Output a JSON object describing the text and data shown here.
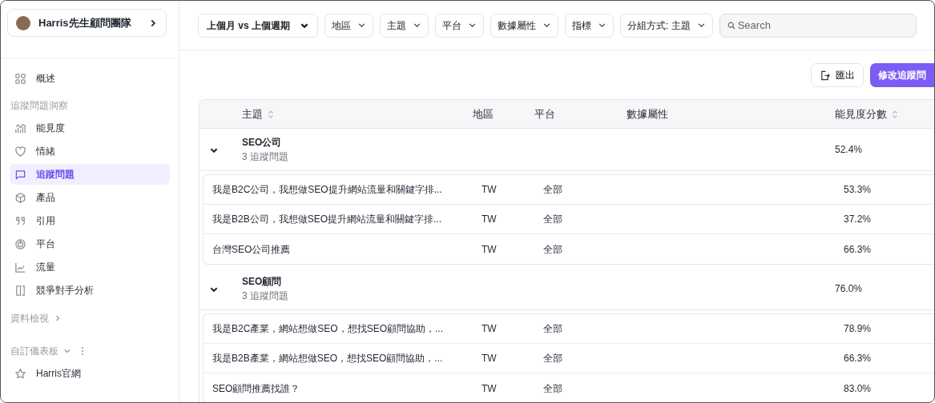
{
  "team": {
    "name": "Harris先生顧問團隊"
  },
  "sidebar": {
    "top_items": [
      {
        "label": "概述",
        "kind": "grid",
        "selected": false
      }
    ],
    "groups": [
      {
        "title": "追蹤問題洞察",
        "kind": "section",
        "items": [
          {
            "label": "能見度",
            "kind": "bars",
            "selected": false
          },
          {
            "label": "情緒",
            "kind": "heart",
            "selected": false
          },
          {
            "label": "追蹤問題",
            "kind": "chat",
            "selected": true
          },
          {
            "label": "產品",
            "kind": "cube",
            "selected": false
          },
          {
            "label": "引用",
            "kind": "quote",
            "selected": false
          },
          {
            "label": "平台",
            "kind": "target",
            "selected": false
          },
          {
            "label": "流量",
            "kind": "trend",
            "selected": false
          },
          {
            "label": "競爭對手分析",
            "kind": "split",
            "selected": false
          }
        ]
      },
      {
        "title": "資料檢視",
        "kind": "toggle",
        "expanded": false
      },
      {
        "title": "自訂儀表板",
        "kind": "toggle",
        "expanded": true,
        "has_menu": true,
        "items": [
          {
            "label": "Harris官網",
            "kind": "star",
            "selected": false
          }
        ]
      }
    ]
  },
  "filters": [
    {
      "label": "上個月 vs 上個週期",
      "kind": "period"
    },
    {
      "label": "地區",
      "kind": "dropdown"
    },
    {
      "label": "主題",
      "kind": "dropdown"
    },
    {
      "label": "平台",
      "kind": "dropdown"
    },
    {
      "label": "數據屬性",
      "kind": "dropdown"
    },
    {
      "label": "指標",
      "kind": "dropdown"
    },
    {
      "label": "分組方式: 主題",
      "kind": "dropdown"
    }
  ],
  "search": {
    "placeholder": "Search"
  },
  "actions": [
    {
      "label": "匯出",
      "kind": "export"
    },
    {
      "label": "修改追蹤問",
      "kind": "primary"
    }
  ],
  "table": {
    "columns": [
      {
        "label": "主題",
        "sortable": true
      },
      {
        "label": "地區",
        "sortable": false
      },
      {
        "label": "平台",
        "sortable": false
      },
      {
        "label": "數據屬性",
        "sortable": false
      },
      {
        "label": "能見度分數",
        "sortable": true
      }
    ],
    "groups": [
      {
        "name": "SEO公司",
        "count": "3 追蹤問題",
        "expanded": true,
        "score": "52.4%",
        "rows": [
          {
            "question": "我是B2C公司，我想做SEO提升網站流量和關鍵字排...",
            "region": "TW",
            "platform": "全部",
            "score": "53.3%"
          },
          {
            "question": "我是B2B公司，我想做SEO提升網站流量和關鍵字排...",
            "region": "TW",
            "platform": "全部",
            "score": "37.2%"
          },
          {
            "question": "台灣SEO公司推薦",
            "region": "TW",
            "platform": "全部",
            "score": "66.3%"
          }
        ]
      },
      {
        "name": "SEO顧問",
        "count": "3 追蹤問題",
        "expanded": true,
        "score": "76.0%",
        "rows": [
          {
            "question": "我是B2C產業，網站想做SEO，想找SEO顧問協助，...",
            "region": "TW",
            "platform": "全部",
            "score": "78.9%"
          },
          {
            "question": "我是B2B產業，網站想做SEO，想找SEO顧問協助，...",
            "region": "TW",
            "platform": "全部",
            "score": "66.3%"
          },
          {
            "question": "SEO顧問推薦找誰？",
            "region": "TW",
            "platform": "全部",
            "score": "83.0%"
          }
        ]
      }
    ]
  }
}
